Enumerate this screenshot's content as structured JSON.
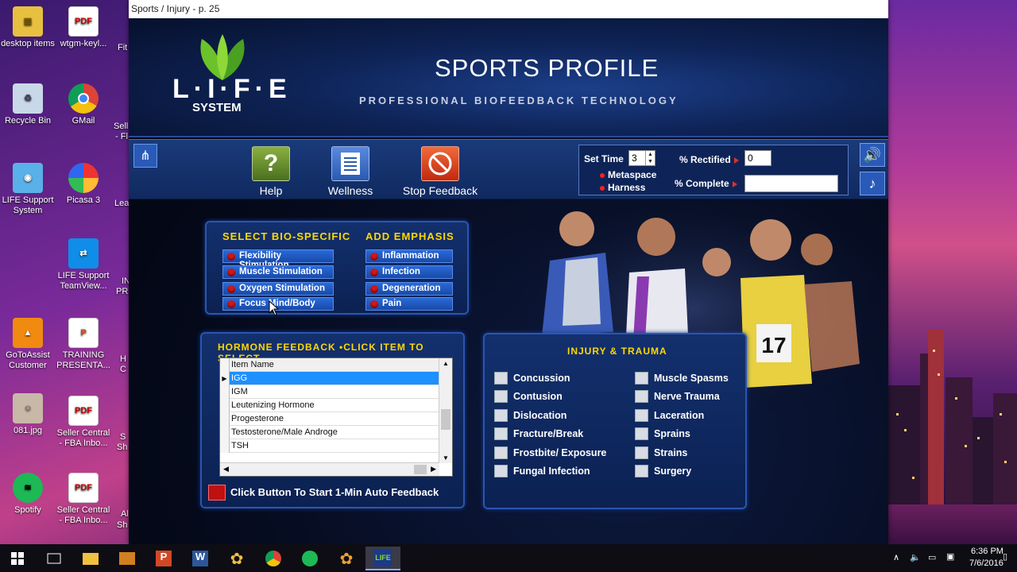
{
  "desktop": {
    "icons": [
      {
        "label": "desktop items",
        "icon": "folder-icon"
      },
      {
        "label": "wtgm-keyl...",
        "icon": "pdf-icon"
      },
      {
        "label": "Recycle Bin",
        "icon": "recycle-bin-icon"
      },
      {
        "label": "GMail",
        "icon": "chrome-icon"
      },
      {
        "label": "LIFE Support System",
        "icon": "life-support-icon"
      },
      {
        "label": "Picasa 3",
        "icon": "picasa-icon"
      },
      {
        "label": "LIFE Support TeamView...",
        "icon": "teamviewer-icon"
      },
      {
        "label": "GoToAssist Customer",
        "icon": "gotoassist-icon"
      },
      {
        "label": "TRAINING PRESENTA...",
        "icon": "powerpoint-icon"
      },
      {
        "label": "081.jpg",
        "icon": "photo-icon"
      },
      {
        "label": "Seller Central - FBA Inbo...",
        "icon": "pdf-icon"
      },
      {
        "label": "Spotify",
        "icon": "spotify-icon"
      },
      {
        "label": "Seller Central - FBA Inbo...",
        "icon": "pdf-icon"
      }
    ],
    "partials": [
      "Fit",
      "Sell",
      "- Fl",
      "Lea",
      "IN",
      "PR",
      "H",
      "C",
      "S",
      "Sh",
      "Al",
      "Sh"
    ]
  },
  "window": {
    "title": "Sports / Injury - p. 25"
  },
  "header": {
    "logo_text": "L·I·F·E",
    "logo_system": "SYSTEM",
    "title": "SPORTS PROFILE",
    "subtitle": "PROFESSIONAL BIOFEEDBACK TECHNOLOGY"
  },
  "toolbar": {
    "help_label": "Help",
    "wellness_label": "Wellness",
    "stop_label": "Stop Feedback"
  },
  "controls": {
    "set_time_label": "Set Time",
    "set_time_value": "3",
    "metaspace_label": "Metaspace",
    "harness_label": "Harness",
    "rectified_label": "% Rectified",
    "rectified_value": "0",
    "complete_label": "% Complete",
    "complete_value": ""
  },
  "bio": {
    "heading_left": "SELECT BIO-SPECIFIC",
    "heading_right": "ADD EMPHASIS",
    "left": [
      "Flexibility Stimulation",
      "Muscle Stimulation",
      "Oxygen Stimulation",
      "Focus Mind/Body"
    ],
    "right": [
      "Inflammation",
      "Infection",
      "Degeneration",
      "Pain"
    ]
  },
  "hormone": {
    "heading": "HORMONE FEEDBACK •CLICK ITEM TO SELECT",
    "column": "Item Name",
    "items": [
      "IGG",
      "IGM",
      "Leutenizing Hormone",
      "Progesterone",
      "Testosterone/Male Androge",
      "TSH"
    ],
    "selected": "IGG",
    "auto_label": "Click Button To Start 1-Min Auto Feedback"
  },
  "injury": {
    "heading": "INJURY & TRAUMA",
    "left": [
      "Concussion",
      "Contusion",
      "Dislocation",
      "Fracture/Break",
      "Frostbite/ Exposure",
      "Fungal Infection"
    ],
    "right": [
      "Muscle Spasms",
      "Nerve Trauma",
      "Laceration",
      "Sprains",
      "Strains",
      "Surgery"
    ]
  },
  "athletes": {
    "bib": "17"
  },
  "taskbar": {
    "time": "6:36 PM",
    "date": "7/6/2016"
  }
}
